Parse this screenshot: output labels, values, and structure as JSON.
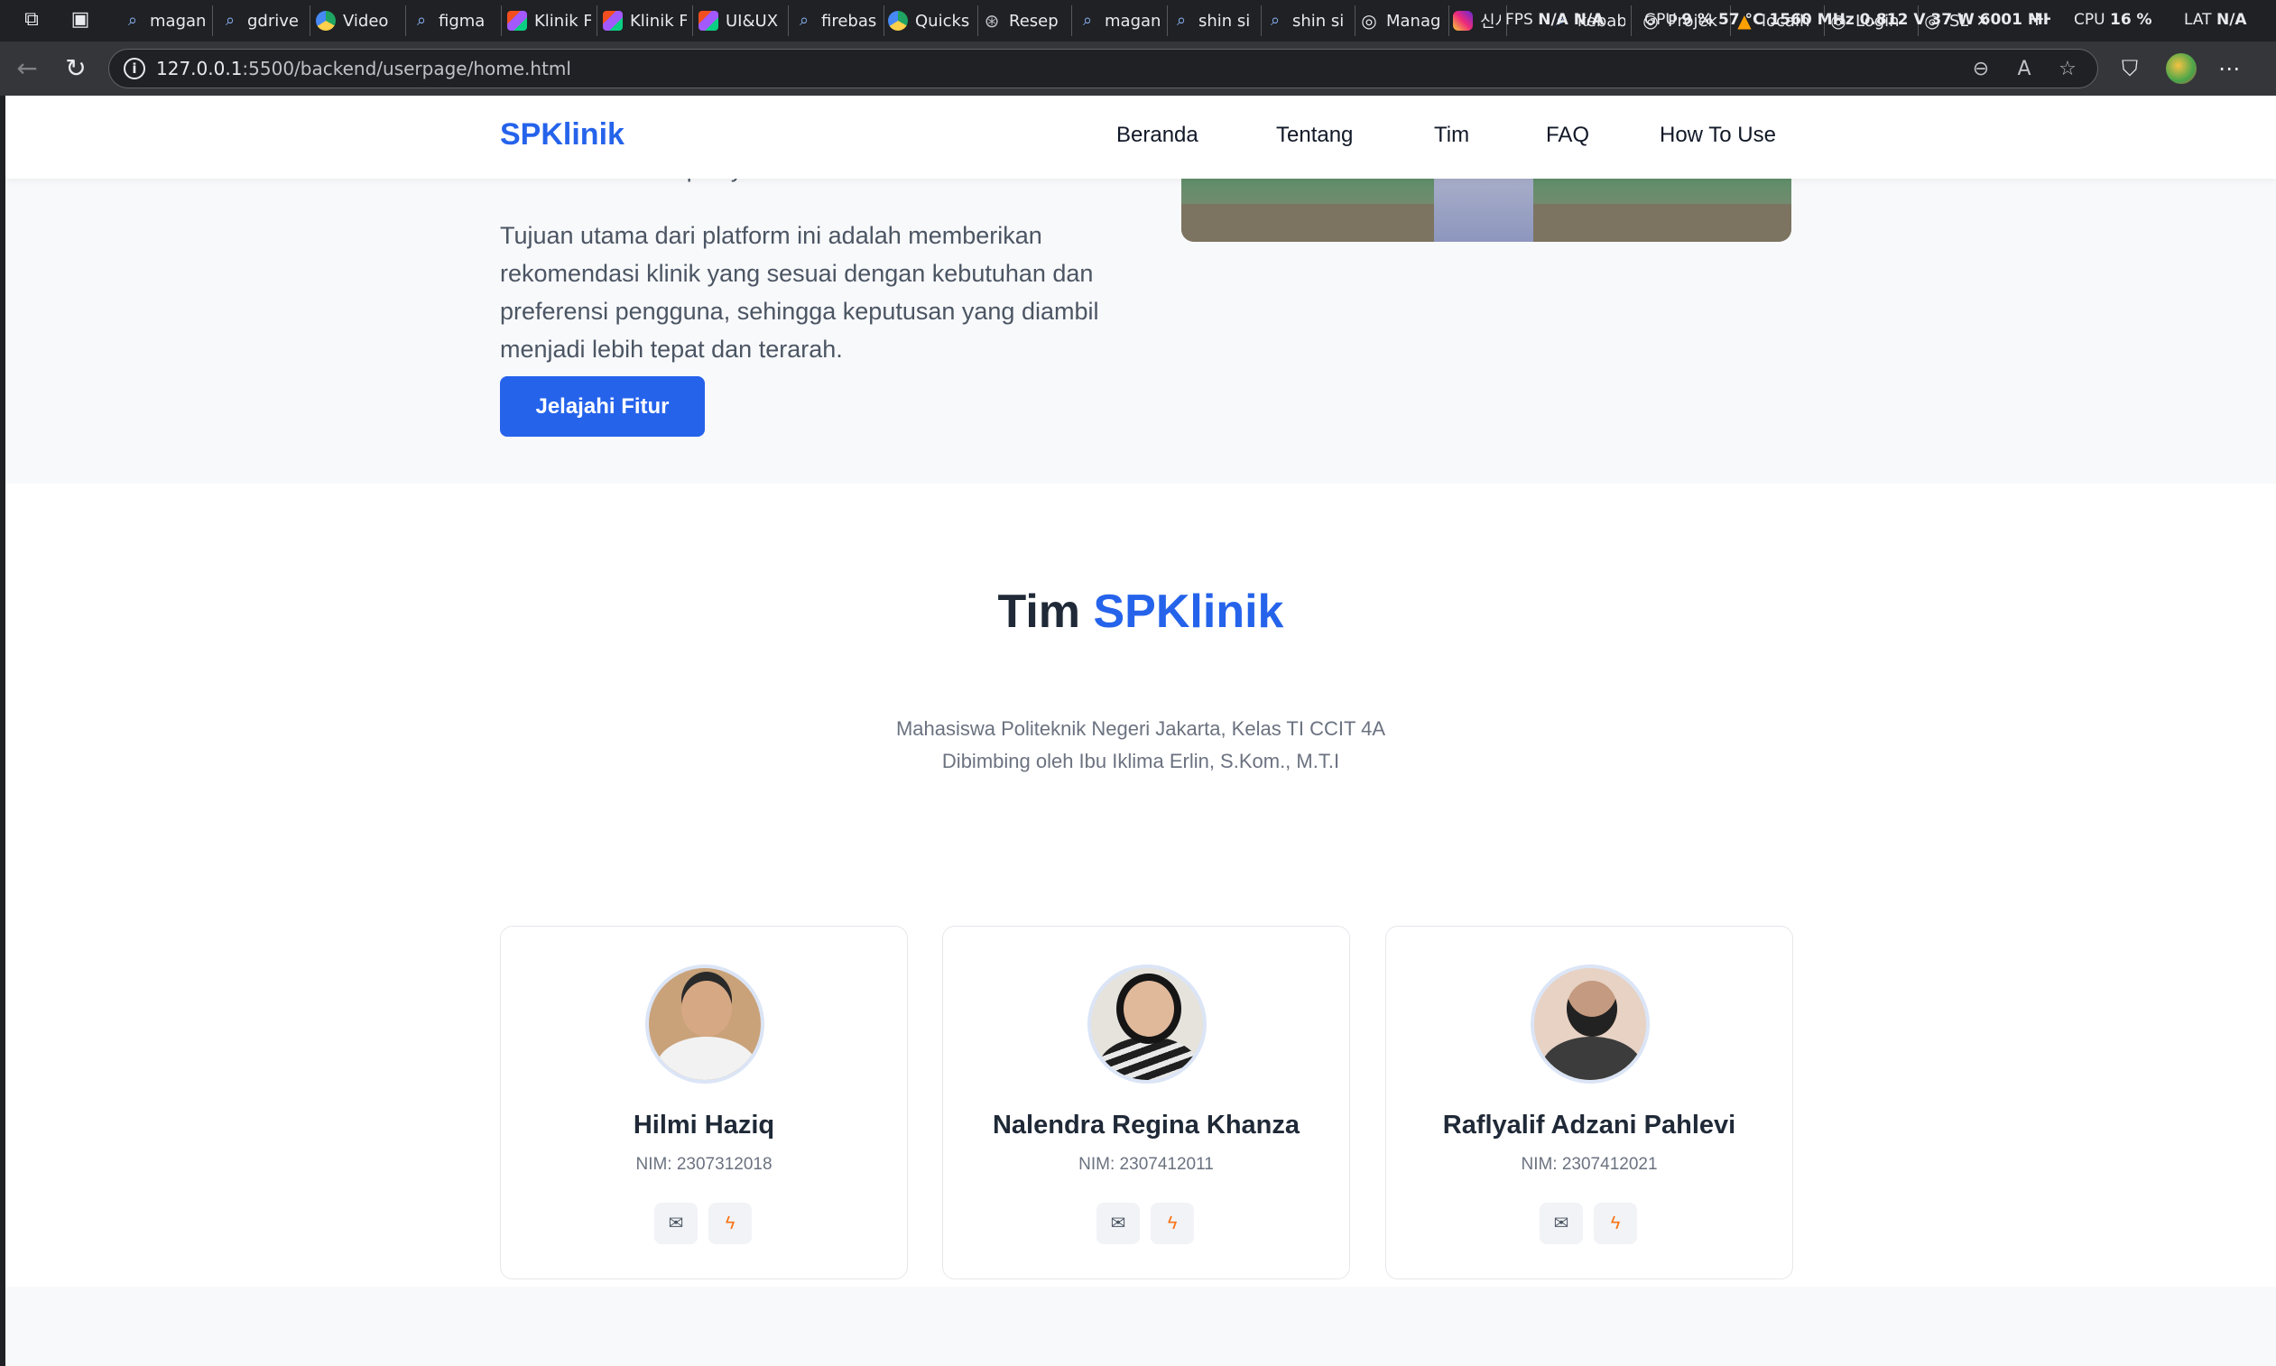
{
  "browser": {
    "tabs": [
      {
        "icon": "search-icon",
        "label": "magan"
      },
      {
        "icon": "search-icon",
        "label": "gdrive"
      },
      {
        "icon": "drive-icon",
        "label": "Video"
      },
      {
        "icon": "search-icon",
        "label": "figma"
      },
      {
        "icon": "figma-icon",
        "label": "Klinik F"
      },
      {
        "icon": "figma-icon",
        "label": "Klinik F"
      },
      {
        "icon": "figma-icon",
        "label": "UI&UX"
      },
      {
        "icon": "search-icon",
        "label": "firebas"
      },
      {
        "icon": "drive-icon",
        "label": "Quicks"
      },
      {
        "icon": "chatgpt-icon",
        "label": "Resep"
      },
      {
        "icon": "search-icon",
        "label": "magan"
      },
      {
        "icon": "search-icon",
        "label": "shin si"
      },
      {
        "icon": "search-icon",
        "label": "shin si"
      },
      {
        "icon": "globe-icon",
        "label": "Manag"
      },
      {
        "icon": "instagram-icon",
        "label": "신시아"
      },
      {
        "icon": "search-icon",
        "label": "kebab"
      },
      {
        "icon": "globe-icon",
        "label": "Projek"
      },
      {
        "icon": "xampp-icon",
        "label": "localh"
      },
      {
        "icon": "globe-icon",
        "label": "Login"
      },
      {
        "icon": "globe-icon",
        "label": "SL"
      }
    ],
    "perf": {
      "fps_label": "FPS",
      "fps_values": "N/A N/A",
      "gpu_label": "GPU",
      "gpu_values": "9 % 57 °C 1560 MHz 0.812 V 37 W 6001 MHz",
      "cpu_label": "CPU",
      "cpu_value": "16 %",
      "lat_label": "LAT",
      "lat_value": "N/A"
    },
    "url_host": "127.0.0.1",
    "url_path": ":5500/backend/userpage/home.html"
  },
  "navbar": {
    "brand": "SPKlinik",
    "links": [
      "Beranda",
      "Tentang",
      "Tim",
      "FAQ",
      "How To Use"
    ]
  },
  "about": {
    "cut_line": "dan ketersediaan pelayanan.",
    "paragraph": "Tujuan utama dari platform ini adalah memberikan rekomendasi klinik yang sesuai dengan kebutuhan dan preferensi pengguna, sehingga keputusan yang diambil menjadi lebih tepat dan terarah.",
    "cta": "Jelajahi Fitur"
  },
  "team": {
    "title_prefix": "Tim",
    "title_accent": "SPKlinik",
    "subtitle_1": "Mahasiswa Politeknik Negeri Jakarta, Kelas TI CCIT 4A",
    "subtitle_2": "Dibimbing oleh Ibu Iklima Erlin, S.Kom., M.T.I",
    "members": [
      {
        "name": "Hilmi Haziq",
        "nim": "NIM: 2307312018"
      },
      {
        "name": "Nalendra Regina Khanza",
        "nim": "NIM: 2307412011"
      },
      {
        "name": "Raflyalif Adzani Pahlevi",
        "nim": "NIM: 2307412021"
      }
    ]
  },
  "colors": {
    "accent": "#2563eb",
    "heading": "#1f2937",
    "muted": "#6b7280",
    "bolt": "#f97316"
  }
}
